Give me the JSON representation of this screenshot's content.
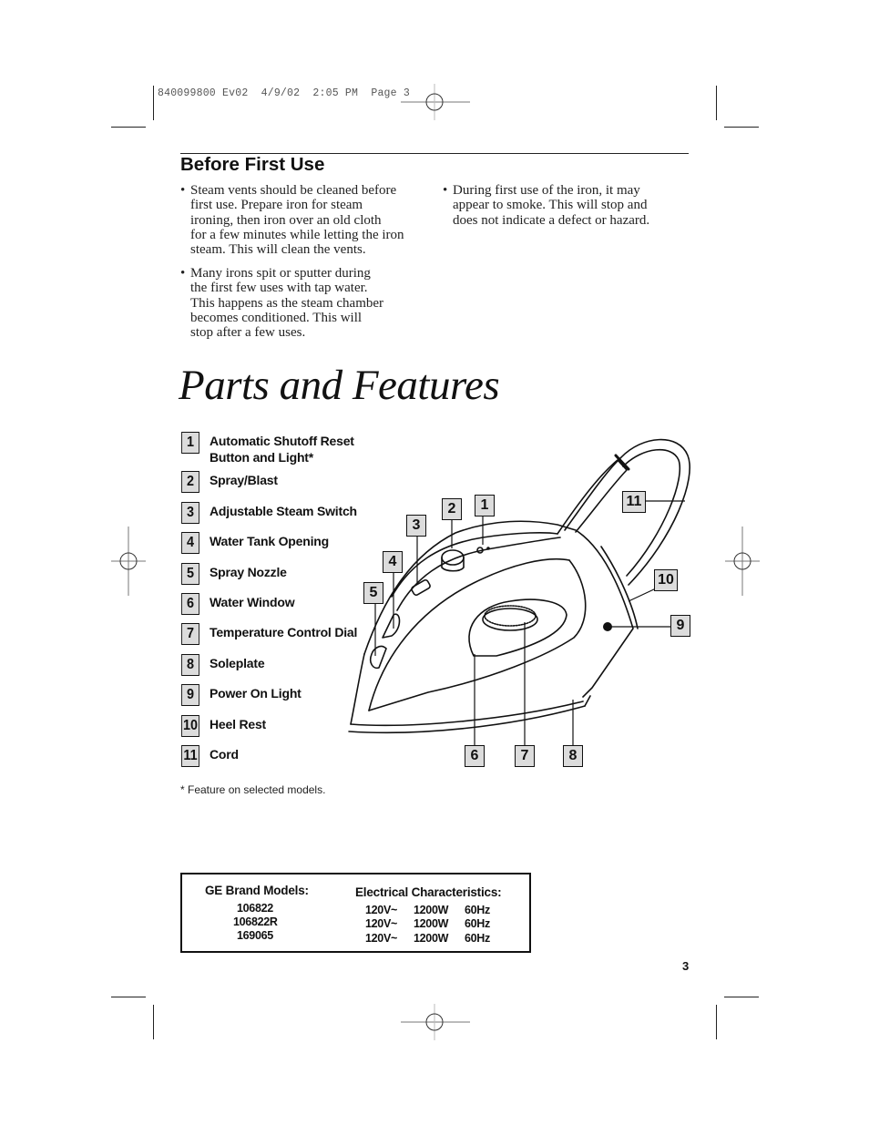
{
  "slug": {
    "text": "840099800 Ev02  4/9/02  2:05 PM  Page 3"
  },
  "before_first_use": {
    "heading": "Before First Use",
    "bullets": [
      {
        "marker": "•",
        "text": "Steam vents should be cleaned before\nfirst use. Prepare iron for steam\nironing, then iron over an old cloth\nfor a few minutes while letting the iron\nsteam. This will clean the vents."
      },
      {
        "marker": "•",
        "text": "Many irons spit or sputter during\nthe first few uses with tap water.\nThis happens as the steam chamber\nbecomes conditioned. This will\nstop after a few uses."
      },
      {
        "marker": "•",
        "text": "During first use of the iron, it may\nappear to smoke. This will stop and\ndoes not indicate a defect or hazard."
      }
    ]
  },
  "parts_and_features": {
    "title": "Parts and Features",
    "parts": [
      {
        "number": "1",
        "label": "Automatic Shutoff Reset\nButton and Light*"
      },
      {
        "number": "2",
        "label": "Spray/Blast"
      },
      {
        "number": "3",
        "label": "Adjustable Steam Switch"
      },
      {
        "number": "4",
        "label": "Water Tank Opening"
      },
      {
        "number": "5",
        "label": "Spray Nozzle"
      },
      {
        "number": "6",
        "label": "Water Window"
      },
      {
        "number": "7",
        "label": "Temperature Control Dial"
      },
      {
        "number": "8",
        "label": "Soleplate"
      },
      {
        "number": "9",
        "label": "Power On Light"
      },
      {
        "number": "10",
        "label": "Heel Rest"
      },
      {
        "number": "11",
        "label": "Cord"
      }
    ],
    "footnote": "* Feature on selected models.",
    "diagram_callouts": [
      "1",
      "2",
      "3",
      "4",
      "5",
      "6",
      "7",
      "8",
      "9",
      "10",
      "11"
    ]
  },
  "specs": {
    "models_heading": "GE Brand Models:",
    "models": [
      "106822",
      "106822R",
      "169065"
    ],
    "electrical_heading": "Electrical Characteristics:",
    "electrical": [
      {
        "voltage": "120V~",
        "wattage": "1200W",
        "frequency": "60Hz"
      },
      {
        "voltage": "120V~",
        "wattage": "1200W",
        "frequency": "60Hz"
      },
      {
        "voltage": "120V~",
        "wattage": "1200W",
        "frequency": "60Hz"
      }
    ]
  },
  "page_number": "3"
}
